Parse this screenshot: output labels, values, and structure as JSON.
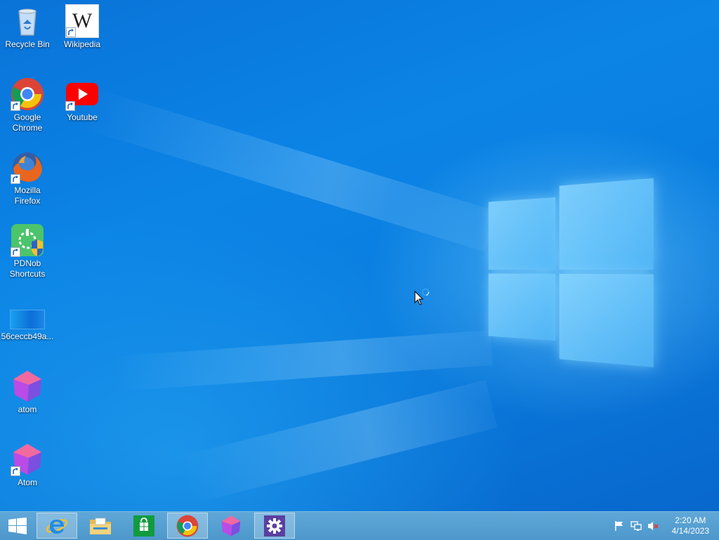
{
  "desktop_icons": [
    {
      "label": "Recycle Bin",
      "icon": "recycle-bin-icon"
    },
    {
      "label": "Wikipedia",
      "icon": "wikipedia-icon",
      "glyph": "W"
    },
    {
      "label": "Google Chrome",
      "icon": "chrome-icon"
    },
    {
      "label": "Youtube",
      "icon": "youtube-icon"
    },
    {
      "label": "Mozilla Firefox",
      "icon": "firefox-icon"
    },
    {
      "label": "PDNob Shortcuts",
      "icon": "pdnob-icon"
    },
    {
      "label": "56ceccb49a...",
      "icon": "image-file-icon"
    },
    {
      "label": "atom",
      "icon": "atom-icon"
    },
    {
      "label": "Atom",
      "icon": "atom-icon"
    }
  ],
  "taskbar": {
    "apps": [
      {
        "name": "Start",
        "icon": "windows-start-icon"
      },
      {
        "name": "Internet Explorer",
        "icon": "internet-explorer-icon"
      },
      {
        "name": "File Explorer",
        "icon": "file-explorer-icon"
      },
      {
        "name": "Store",
        "icon": "store-icon"
      },
      {
        "name": "Google Chrome",
        "icon": "chrome-icon"
      },
      {
        "name": "Atom",
        "icon": "atom-icon"
      },
      {
        "name": "Settings",
        "icon": "gear-icon"
      }
    ],
    "tray": [
      "action-center-flag-icon",
      "network-icon",
      "volume-muted-icon"
    ],
    "clock": {
      "time": "2:20 AM",
      "date": "4/14/2023"
    }
  },
  "colors": {
    "desktop_blue": "#0b84e6",
    "taskbar": "#559fd1",
    "youtube_red": "#ff0000",
    "store_green": "#119b3f",
    "settings_purple": "#5b3fa0"
  }
}
